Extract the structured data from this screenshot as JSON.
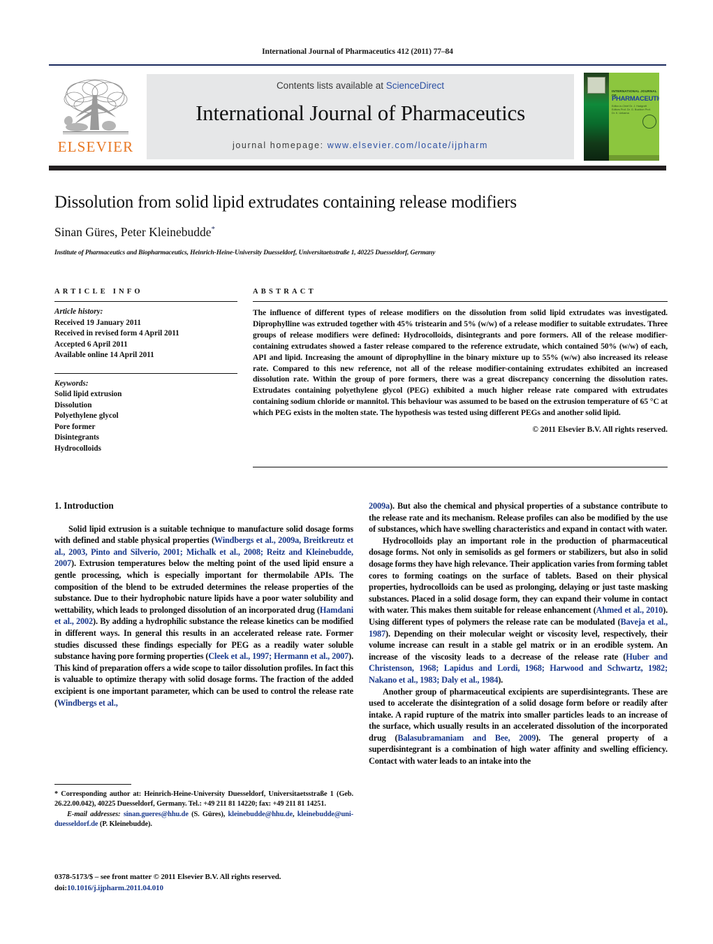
{
  "running_head": "International Journal of Pharmaceutics 412 (2011) 77–84",
  "masthead": {
    "contents_prefix": "Contents lists available at ",
    "sciencedirect": "ScienceDirect",
    "journal_name": "International Journal of Pharmaceutics",
    "homepage_prefix": "journal homepage: ",
    "homepage_url": "www.elsevier.com/locate/ijpharm",
    "publisher_logo_text": "ELSEVIER",
    "cover": {
      "header": "INTERNATIONAL JOURNAL OF",
      "title": "PHARMACEUTICS",
      "subtitle": "Editor-in-Chief  Dr. J. Hadgraft  Editors  Prof. Dr. G. Buckton  Prof. Dr. K. Uekama"
    },
    "accent_blue": "#2b4fa2",
    "elsevier_orange": "#e87722",
    "cover_green": "#8cc63e"
  },
  "article": {
    "title": "Dissolution from solid lipid extrudates containing release modifiers",
    "authors": "Sinan Güres, Peter Kleinebudde",
    "corresponding_marker": "*",
    "affiliation": "Institute of Pharmaceutics and Biopharmaceutics, Heinrich-Heine-University Duesseldorf, Universitaetsstraße 1, 40225 Duesseldorf, Germany"
  },
  "article_info": {
    "heading": "ARTICLE INFO",
    "history_label": "Article history:",
    "history": [
      "Received 19 January 2011",
      "Received in revised form 4 April 2011",
      "Accepted 6 April 2011",
      "Available online 14 April 2011"
    ],
    "keywords_label": "Keywords:",
    "keywords": [
      "Solid lipid extrusion",
      "Dissolution",
      "Polyethylene glycol",
      "Pore former",
      "Disintegrants",
      "Hydrocolloids"
    ]
  },
  "abstract": {
    "heading": "ABSTRACT",
    "text": "The influence of different types of release modifiers on the dissolution from solid lipid extrudates was investigated. Diprophylline was extruded together with 45% tristearin and 5% (w/w) of a release modifier to suitable extrudates. Three groups of release modifiers were defined: Hydrocolloids, disintegrants and pore formers. All of the release modifier-containing extrudates showed a faster release compared to the reference extrudate, which contained 50% (w/w) of each, API and lipid. Increasing the amount of diprophylline in the binary mixture up to 55% (w/w) also increased its release rate. Compared to this new reference, not all of the release modifier-containing extrudates exhibited an increased dissolution rate. Within the group of pore formers, there was a great discrepancy concerning the dissolution rates. Extrudates containing polyethylene glycol (PEG) exhibited a much higher release rate compared with extrudates containing sodium chloride or mannitol. This behaviour was assumed to be based on the extrusion temperature of 65 °C at which PEG exists in the molten state. The hypothesis was tested using different PEGs and another solid lipid.",
    "copyright": "© 2011 Elsevier B.V. All rights reserved."
  },
  "body": {
    "section_heading": "1. Introduction",
    "left_paragraphs": [
      {
        "segments": [
          {
            "t": "Solid lipid extrusion is a suitable technique to manufacture solid dosage forms with defined and stable physical properties (",
            "ref": false
          },
          {
            "t": "Windbergs et al., 2009a, Breitkreutz et al., 2003, Pinto and Silverio, 2001; Michalk et al., 2008; Reitz and Kleinebudde, 2007",
            "ref": true
          },
          {
            "t": "). Extrusion temperatures below the melting point of the used lipid ensure a gentle processing, which is especially important for thermolabile APIs. The composition of the blend to be extruded determines the release properties of the substance. Due to their hydrophobic nature lipids have a poor water solubility and wettability, which leads to prolonged dissolution of an incorporated drug (",
            "ref": false
          },
          {
            "t": "Hamdani et al., 2002",
            "ref": true
          },
          {
            "t": "). By adding a hydrophilic substance the release kinetics can be modified in different ways. In general this results in an accelerated release rate. Former studies discussed these findings especially for PEG as a readily water soluble substance having pore forming properties (",
            "ref": false
          },
          {
            "t": "Cleek et al., 1997; Hermann et al., 2007",
            "ref": true
          },
          {
            "t": "). This kind of preparation offers a wide scope to tailor dissolution profiles. In fact this is valuable to optimize therapy with solid dosage forms. The fraction of the added excipient is one important parameter, which can be used to control the release rate (",
            "ref": false
          },
          {
            "t": "Windbergs et al.,",
            "ref": true
          }
        ]
      }
    ],
    "right_paragraphs": [
      {
        "indent": false,
        "segments": [
          {
            "t": "2009a",
            "ref": true
          },
          {
            "t": "). But also the chemical and physical properties of a substance contribute to the release rate and its mechanism. Release profiles can also be modified by the use of substances, which have swelling characteristics and expand in contact with water.",
            "ref": false
          }
        ]
      },
      {
        "indent": true,
        "segments": [
          {
            "t": "Hydrocolloids play an important role in the production of pharmaceutical dosage forms. Not only in semisolids as gel formers or stabilizers, but also in solid dosage forms they have high relevance. Their application varies from forming tablet cores to forming coatings on the surface of tablets. Based on their physical properties, hydrocolloids can be used as prolonging, delaying or just taste masking substances. Placed in a solid dosage form, they can expand their volume in contact with water. This makes them suitable for release enhancement (",
            "ref": false
          },
          {
            "t": "Ahmed et al., 2010",
            "ref": true
          },
          {
            "t": "). Using different types of polymers the release rate can be modulated (",
            "ref": false
          },
          {
            "t": "Baveja et al., 1987",
            "ref": true
          },
          {
            "t": "). Depending on their molecular weight or viscosity level, respectively, their volume increase can result in a stable gel matrix or in an erodible system. An increase of the viscosity leads to a decrease of the release rate (",
            "ref": false
          },
          {
            "t": "Huber and Christenson, 1968; Lapidus and Lordi, 1968; Harwood and Schwartz, 1982; Nakano et al., 1983; Daly et al., 1984",
            "ref": true
          },
          {
            "t": ").",
            "ref": false
          }
        ]
      },
      {
        "indent": true,
        "segments": [
          {
            "t": "Another group of pharmaceutical excipients are superdisintegrants. These are used to accelerate the disintegration of a solid dosage form before or readily after intake. A rapid rupture of the matrix into smaller particles leads to an increase of the surface, which usually results in an accelerated dissolution of the incorporated drug (",
            "ref": false
          },
          {
            "t": "Balasubramaniam and Bee, 2009",
            "ref": true
          },
          {
            "t": "). The general property of a superdisintegrant is a combination of high water affinity and swelling efficiency. Contact with water leads to an intake into the",
            "ref": false
          }
        ]
      }
    ]
  },
  "footnote": {
    "segments": [
      {
        "t": "* Corresponding author at: Heinrich-Heine-University Duesseldorf, Universitaetsstraße 1 (Geb. 26.22.00.042), 40225 Duesseldorf, Germany. Tel.: +49 211 81 14220; fax: +49 211 81 14251.",
        "ref": false,
        "italic": false
      }
    ],
    "email_label": "E-mail addresses:",
    "email_segments": [
      {
        "t": "sinan.gueres@hhu.de",
        "ref": true
      },
      {
        "t": " (S. Güres), ",
        "ref": false
      },
      {
        "t": "kleinebudde@hhu.de",
        "ref": true
      },
      {
        "t": ", ",
        "ref": false
      },
      {
        "t": "kleinebudde@uni-duesseldorf.de",
        "ref": true
      },
      {
        "t": " (P. Kleinebudde).",
        "ref": false
      }
    ]
  },
  "imprint": {
    "line1": "0378-5173/$ – see front matter © 2011 Elsevier B.V. All rights reserved.",
    "doi_label": "doi:",
    "doi": "10.1016/j.ijpharm.2011.04.010"
  }
}
